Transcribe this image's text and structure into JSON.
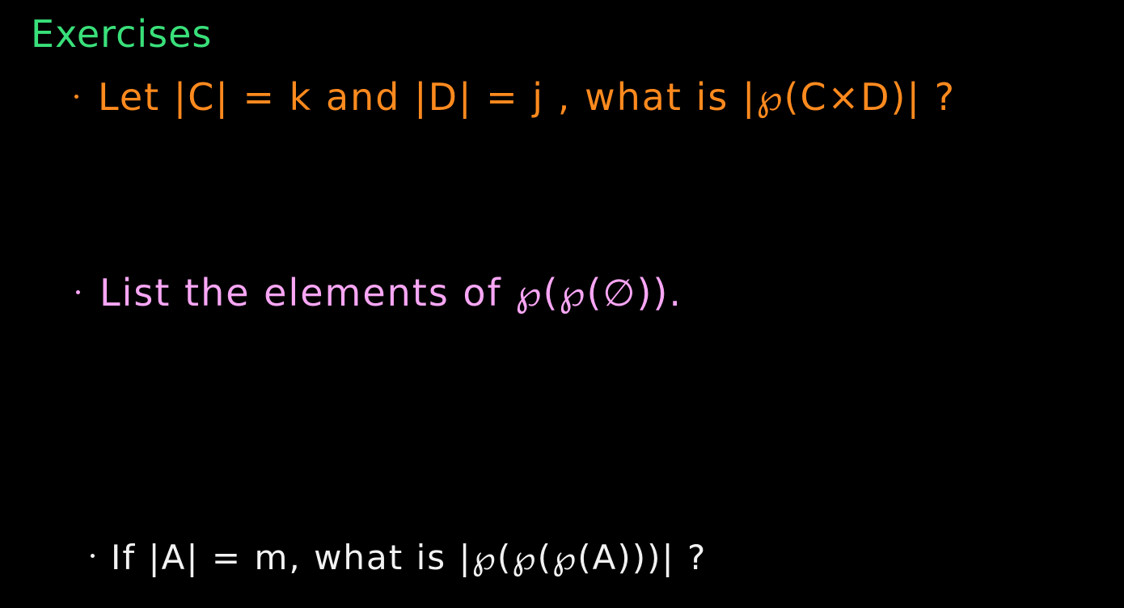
{
  "heading": "Exercises",
  "exercises": [
    {
      "text": "Let |C| = k  and  |D| = j , what is  |℘(C×D)| ?",
      "color": "#ff8a1e"
    },
    {
      "text": "List the elements of  ℘(℘(∅)).",
      "color": "#f9a6f5"
    },
    {
      "text": "If |A| = m, what is  |℘(℘(℘(A)))| ?",
      "color": "#f2f2f2"
    }
  ],
  "heading_color": "#39e07a",
  "background": "#000000"
}
